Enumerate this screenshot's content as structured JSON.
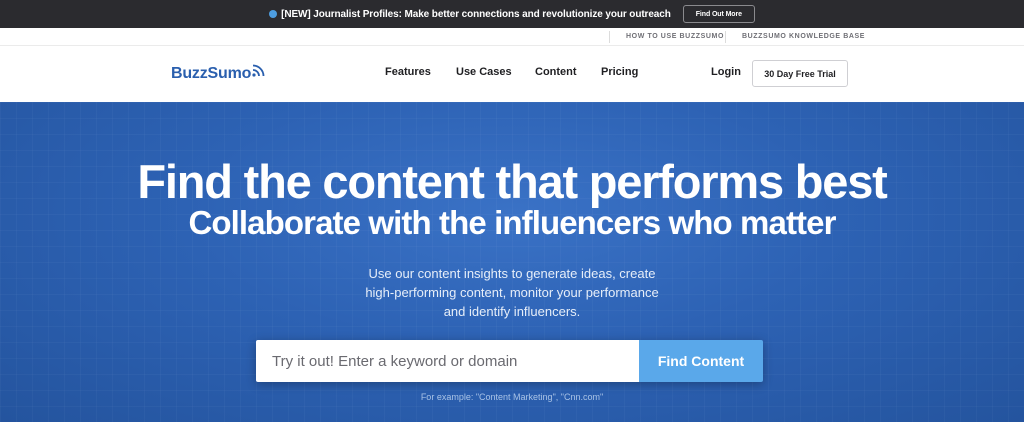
{
  "announcement": {
    "message": "[NEW] Journalist Profiles: Make better connections and revolutionize your outreach",
    "cta": "Find Out More"
  },
  "utility_nav": {
    "how_to": "HOW TO USE BUZZSUMO",
    "knowledge_base": "BUZZSUMO KNOWLEDGE BASE"
  },
  "brand": {
    "name": "BuzzSumo",
    "color": "#2a5fae"
  },
  "nav": {
    "features": "Features",
    "use_cases": "Use Cases",
    "content": "Content",
    "pricing": "Pricing",
    "login": "Login",
    "trial": "30 Day Free Trial"
  },
  "hero": {
    "heading": "Find the content that performs best",
    "subheading": "Collaborate with the influencers who matter",
    "paragraph": "Use our content insights to generate ideas, create high-performing content, monitor your performance and identify influencers.",
    "search_placeholder": "Try it out! Enter a keyword or domain",
    "search_button": "Find Content",
    "example": "For example: \"Content Marketing\", \"Cnn.com\""
  },
  "colors": {
    "announce_bg": "#2b2b2f",
    "hero_bg": "#2d62b4",
    "button_bg": "#5aa8ea"
  }
}
